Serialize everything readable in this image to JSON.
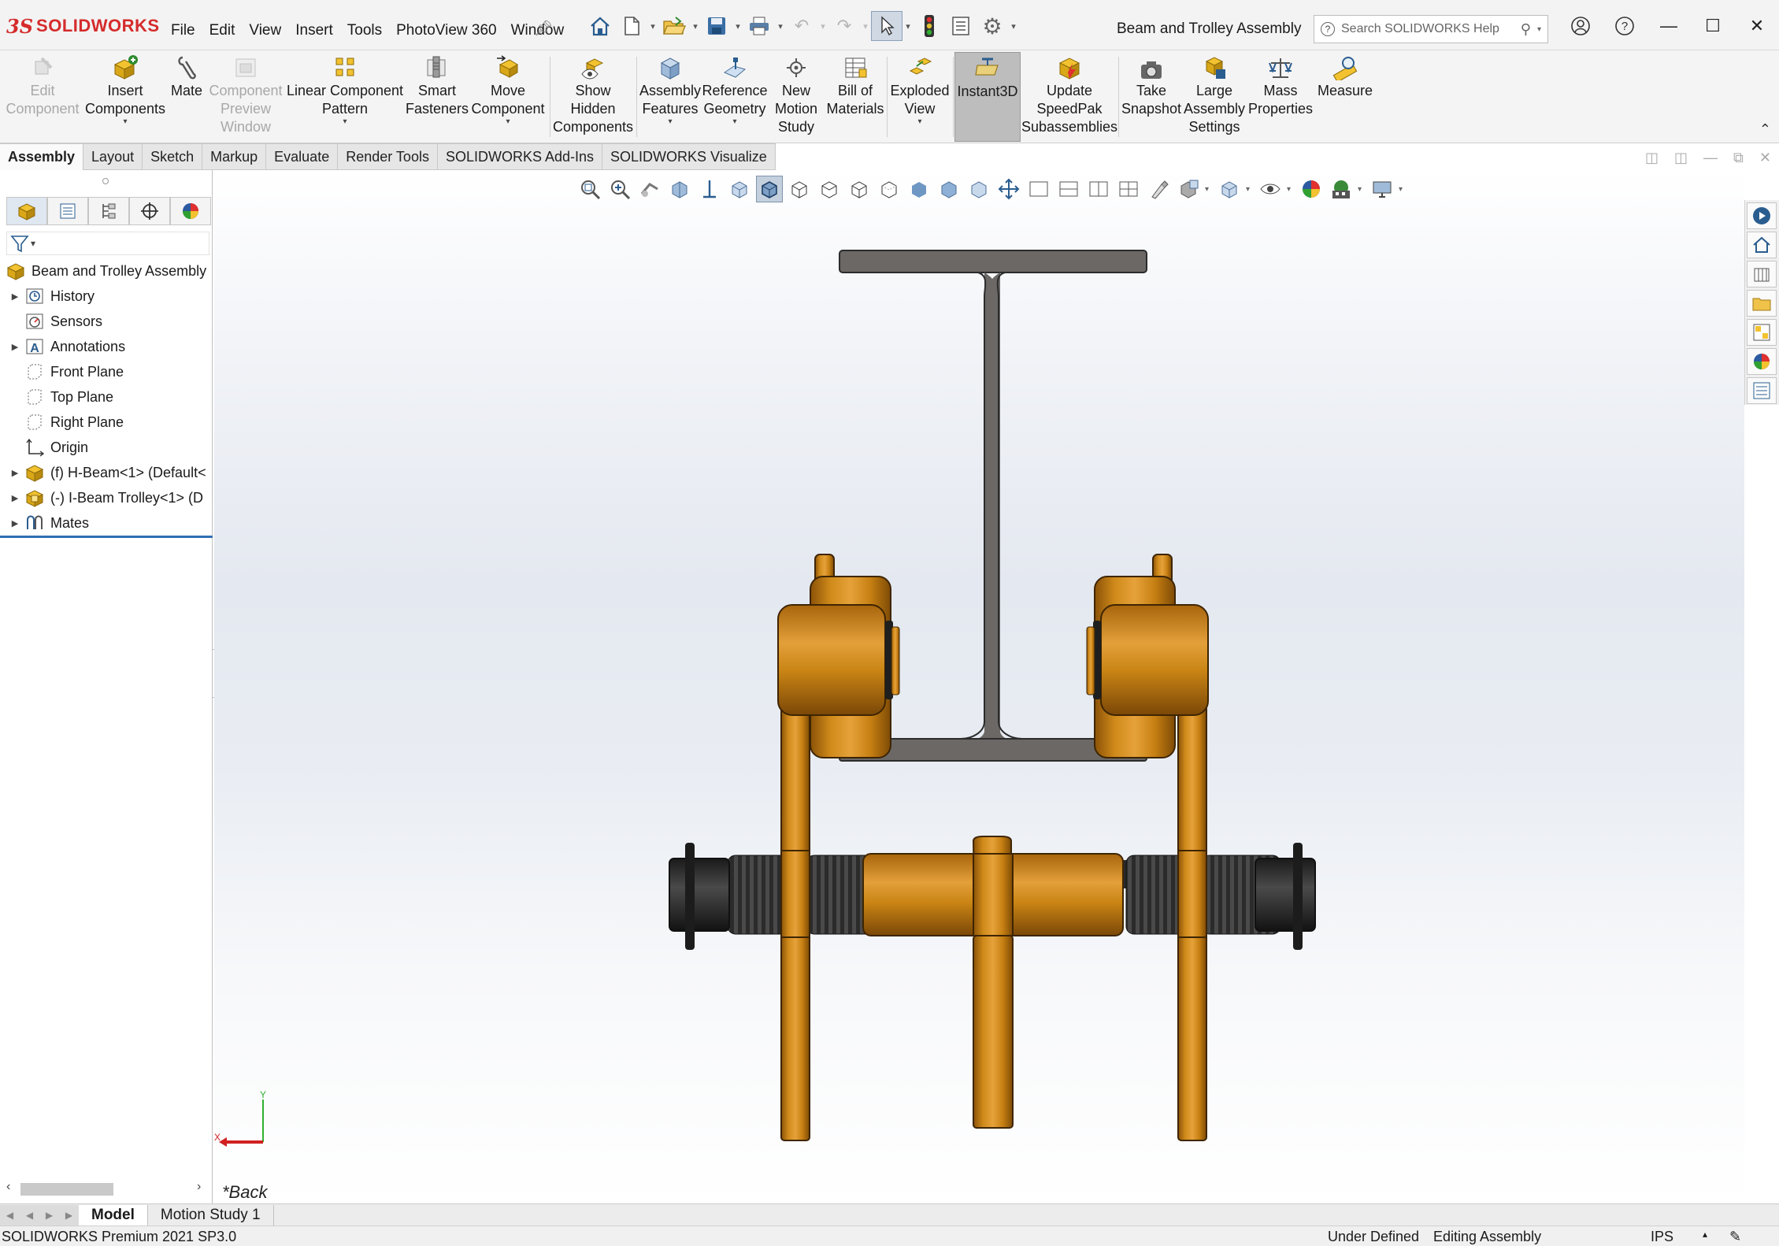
{
  "app": {
    "logo_prefix": "3S",
    "logo_text": "SOLIDWORKS",
    "document_title": "Beam and Trolley Assembly"
  },
  "menu": [
    "File",
    "Edit",
    "View",
    "Insert",
    "Tools",
    "PhotoView 360",
    "Window"
  ],
  "help_search": {
    "placeholder": "Search SOLIDWORKS Help"
  },
  "ribbon": [
    {
      "label": "Edit\nComponent",
      "disabled": true
    },
    {
      "label": "Insert\nComponents",
      "dropdown": true
    },
    {
      "label": "Mate"
    },
    {
      "label": "Component\nPreview\nWindow",
      "disabled": true
    },
    {
      "label": "Linear Component\nPattern",
      "dropdown": true
    },
    {
      "label": "Smart\nFasteners"
    },
    {
      "label": "Move\nComponent",
      "dropdown": true
    },
    {
      "label": "Show\nHidden\nComponents"
    },
    {
      "label": "Assembly\nFeatures",
      "dropdown": true
    },
    {
      "label": "Reference\nGeometry",
      "dropdown": true
    },
    {
      "label": "New\nMotion\nStudy"
    },
    {
      "label": "Bill of\nMaterials"
    },
    {
      "label": "Exploded\nView",
      "dropdown": true
    },
    {
      "label": "Instant3D",
      "active": true
    },
    {
      "label": "Update\nSpeedPak\nSubassemblies"
    },
    {
      "label": "Take\nSnapshot"
    },
    {
      "label": "Large\nAssembly\nSettings"
    },
    {
      "label": "Mass\nProperties"
    },
    {
      "label": "Measure"
    }
  ],
  "tabs": [
    "Assembly",
    "Layout",
    "Sketch",
    "Markup",
    "Evaluate",
    "Render Tools",
    "SOLIDWORKS Add-Ins",
    "SOLIDWORKS Visualize"
  ],
  "active_tab": "Assembly",
  "tree": {
    "root": "Beam and Trolley Assembly",
    "items": [
      {
        "label": "History",
        "expandable": true,
        "icon": "history-icon"
      },
      {
        "label": "Sensors",
        "expandable": false,
        "icon": "sensor-icon"
      },
      {
        "label": "Annotations",
        "expandable": true,
        "icon": "annotations-icon"
      },
      {
        "label": "Front Plane",
        "expandable": false,
        "icon": "plane-icon"
      },
      {
        "label": "Top Plane",
        "expandable": false,
        "icon": "plane-icon"
      },
      {
        "label": "Right Plane",
        "expandable": false,
        "icon": "plane-icon"
      },
      {
        "label": "Origin",
        "expandable": false,
        "icon": "origin-icon"
      },
      {
        "label": "(f) H-Beam<1> (Default<",
        "expandable": true,
        "icon": "part-icon"
      },
      {
        "label": "(-) I-Beam Trolley<1> (D",
        "expandable": true,
        "icon": "subassembly-icon"
      },
      {
        "label": "Mates",
        "expandable": true,
        "icon": "mates-icon"
      }
    ]
  },
  "viewport": {
    "view_name": "*Back",
    "triad_x": "X",
    "triad_y": "Y"
  },
  "bottom_tabs": [
    "Model",
    "Motion Study 1"
  ],
  "status": {
    "product": "SOLIDWORKS Premium 2021 SP3.0",
    "definition": "Under Defined",
    "mode": "Editing Assembly",
    "units": "IPS"
  },
  "colors": {
    "trolley": "#c67f12",
    "beam": "#6b6866",
    "wheel_dark": "#2a2a2a",
    "accent": "#d52b2b"
  }
}
